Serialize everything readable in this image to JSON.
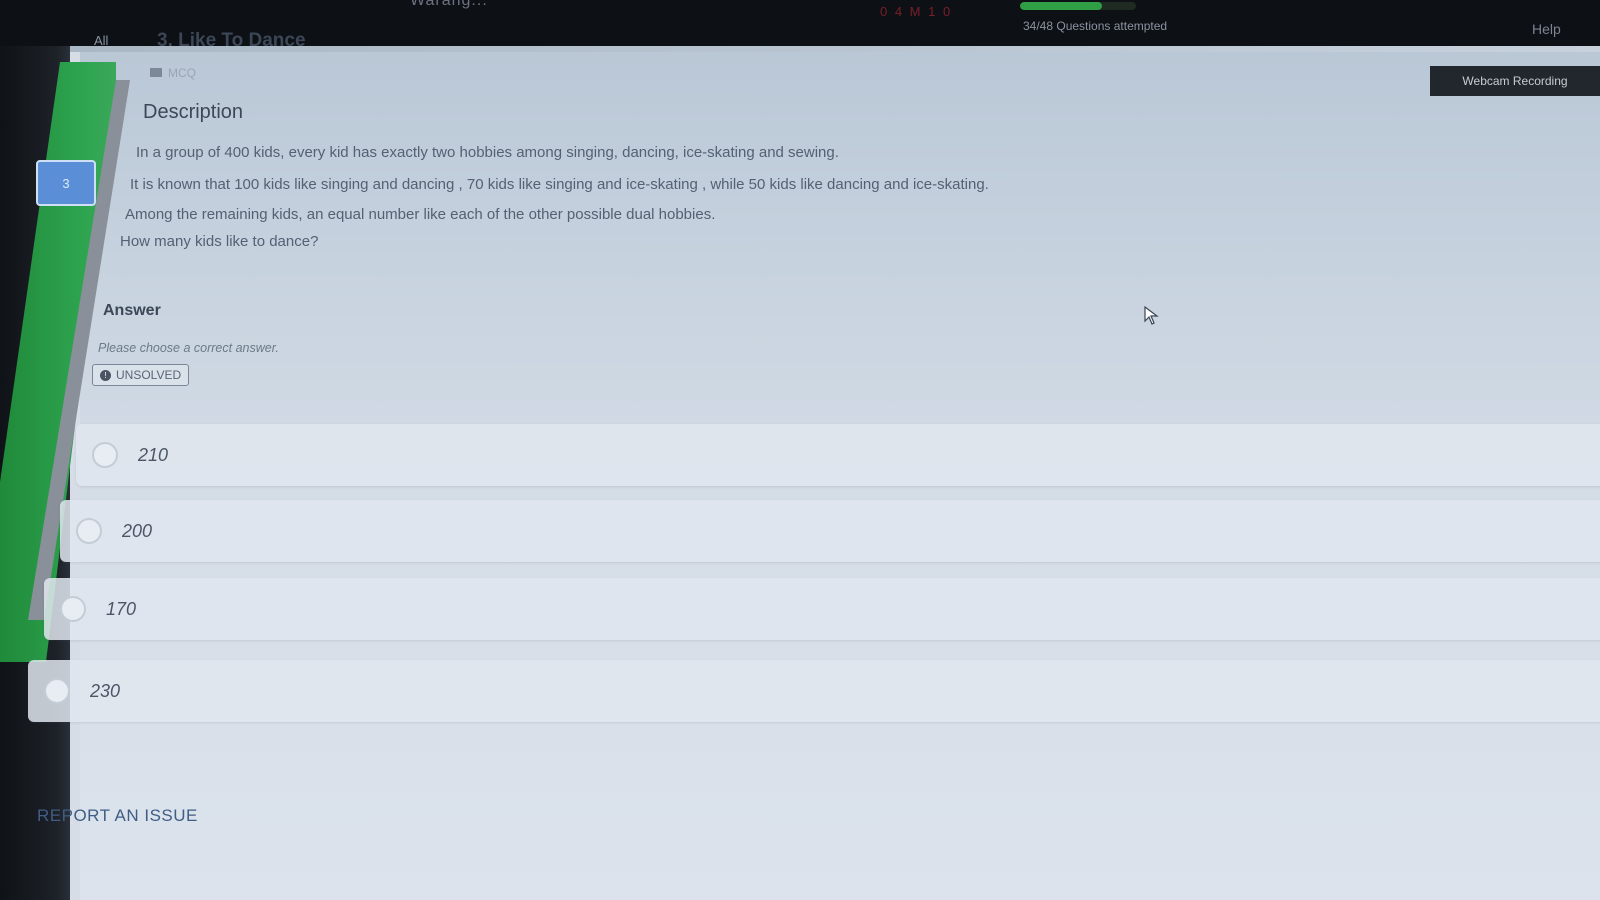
{
  "topbar": {
    "brand": "Warang...",
    "timer": "0 4 M 1 0",
    "progress_fraction": 0.71,
    "attempted": "34/48 Questions attempted",
    "help": "Help"
  },
  "nav": {
    "all_tab": "All",
    "question_number": "3"
  },
  "question": {
    "title": "3. Like To Dance",
    "type_tag": "MCQ",
    "webcam": "Webcam Recording",
    "description_heading": "Description",
    "description_lines": [
      "In a group of 400 kids, every kid has exactly two hobbies among singing, dancing, ice-skating and sewing.",
      "It is known that 100 kids like singing and dancing , 70 kids like singing and ice-skating , while 50 kids like dancing and ice-skating.",
      "Among the remaining kids, an equal number like each of the other possible dual hobbies.",
      "How many kids like to dance?"
    ]
  },
  "answer": {
    "heading": "Answer",
    "hint": "Please choose a correct answer.",
    "status_badge": "UNSOLVED",
    "status_icon_glyph": "!",
    "options": [
      {
        "value": "210"
      },
      {
        "value": "200"
      },
      {
        "value": "170"
      },
      {
        "value": "230"
      }
    ]
  },
  "footer": {
    "report_issue": "REPORT AN ISSUE"
  },
  "colors": {
    "accent_green": "#2ea44f",
    "top_bar": "#0d1014",
    "report_link": "#3f5d86"
  }
}
